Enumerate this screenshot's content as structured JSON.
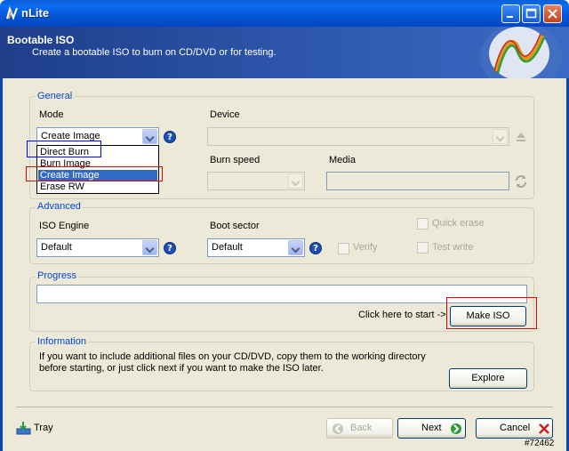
{
  "window": {
    "title": "nLite"
  },
  "header": {
    "title": "Bootable ISO",
    "subtitle": "Create a bootable ISO to burn on CD/DVD or for testing."
  },
  "general": {
    "group_title": "General",
    "mode_label": "Mode",
    "mode_value": "Create Image",
    "mode_options": [
      "Direct Burn",
      "Burn Image",
      "Create Image",
      "Erase RW"
    ],
    "mode_selected_index": 2,
    "device_label": "Device",
    "device_value": "",
    "burn_speed_label": "Burn speed",
    "media_label": "Media",
    "media_value": ""
  },
  "advanced": {
    "group_title": "Advanced",
    "iso_engine_label": "ISO Engine",
    "iso_engine_value": "Default",
    "boot_sector_label": "Boot sector",
    "boot_sector_value": "Default",
    "verify_label": "Verify",
    "quick_erase_label": "Quick erase",
    "test_write_label": "Test write"
  },
  "progress": {
    "group_title": "Progress",
    "hint": "Click here to start ->",
    "make_iso_label": "Make ISO"
  },
  "information": {
    "group_title": "Information",
    "text": "If you want to include additional files on your CD/DVD, copy them to the working directory before starting, or just click next if you want to make the ISO later.",
    "explore_label": "Explore"
  },
  "footer": {
    "tray_label": "Tray",
    "back_label": "Back",
    "next_label": "Next",
    "cancel_label": "Cancel"
  },
  "watermark": "#72462",
  "colors": {
    "titlebar": "#0a5fd9",
    "header": "#2e57ad",
    "group_title": "#0046d5",
    "selection": "#316ac5",
    "annotation_blue": "#0000ff",
    "annotation_red": "#e00000"
  },
  "icons": {
    "app": "nlite-logo-icon",
    "help": "question-icon",
    "refresh": "refresh-icon",
    "eject": "eject-icon",
    "tray": "tray-icon",
    "back": "back-arrow-icon",
    "next": "next-arrow-icon",
    "cancel": "x-icon"
  }
}
